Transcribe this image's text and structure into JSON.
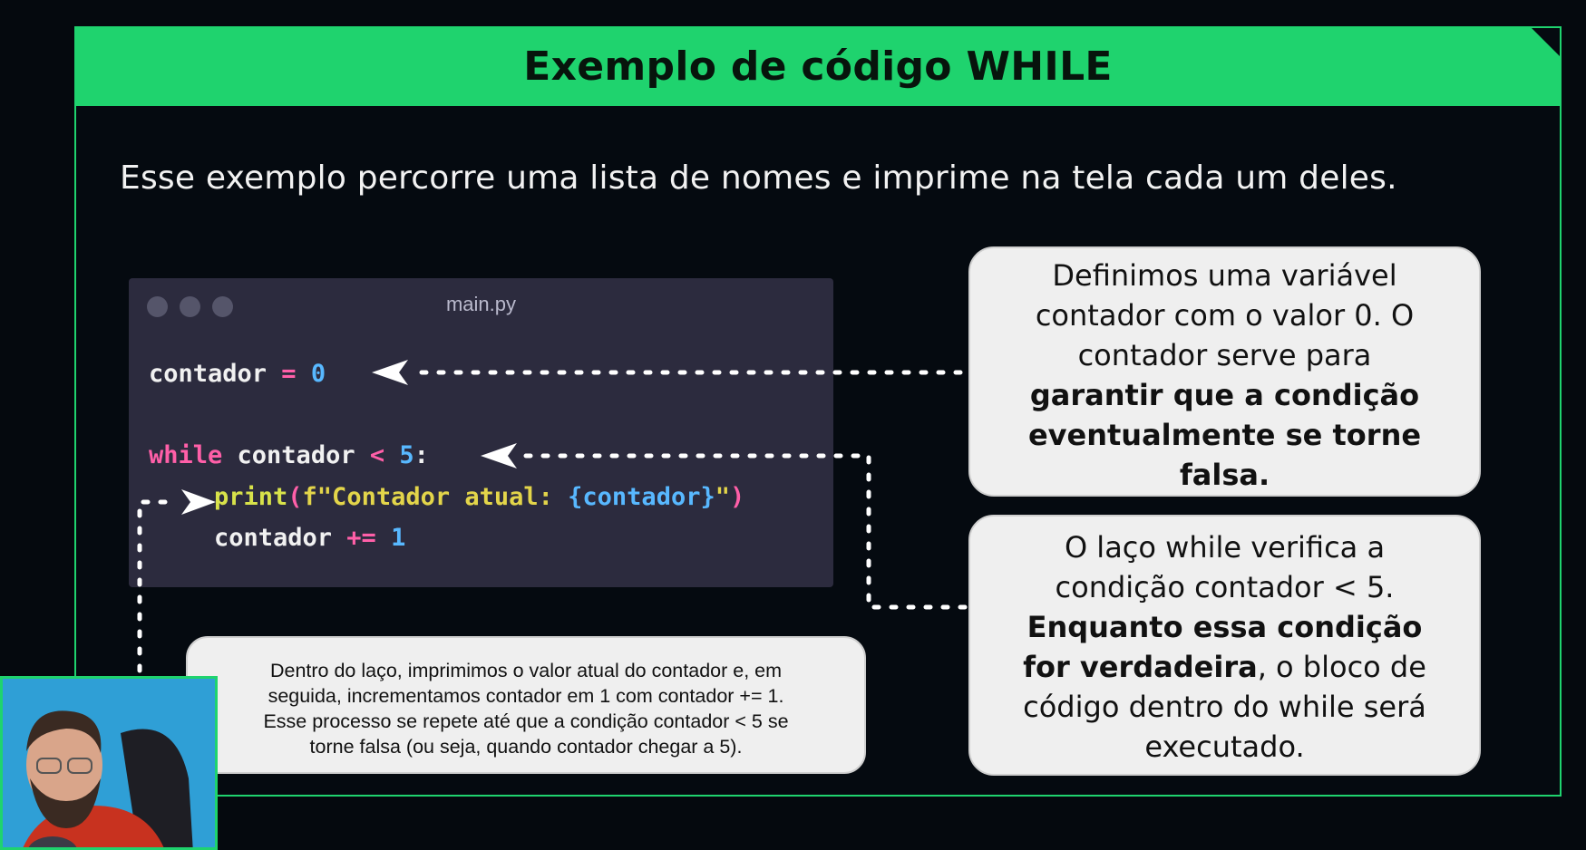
{
  "slide": {
    "title": "Exemplo de código WHILE",
    "intro": "Esse exemplo percorre uma lista de nomes e imprime na tela cada um deles."
  },
  "editor": {
    "filename": "main.py",
    "line1": {
      "var": "contador",
      "op": " = ",
      "num": "0"
    },
    "line2": {
      "kw": "while",
      "var": " contador ",
      "op": "<",
      "num": " 5",
      "punc": ":"
    },
    "line3": {
      "fn": "print",
      "open": "(",
      "str1": "f\"Contador atual: ",
      "brace": "{contador}",
      "str2": "\"",
      "close": ")"
    },
    "line4": {
      "var": "contador",
      "op": " += ",
      "num": "1"
    }
  },
  "callouts": {
    "init": {
      "l1": "Definimos uma variável",
      "l2": "contador com o valor 0. O",
      "l3": "contador serve para",
      "b1": "garantir que a condição",
      "b2": "eventualmente se torne",
      "b3": "falsa."
    },
    "condition": {
      "l1": "O laço while verifica a",
      "l2": "condição contador < 5.",
      "b1": "Enquanto essa condição",
      "b2": "for verdadeira",
      "l3": ", o bloco de",
      "l4": "código dentro do while será",
      "l5": "executado."
    },
    "body": {
      "l1": "Dentro do laço, imprimimos o valor atual do contador e, em",
      "l2": "seguida, incrementamos contador em 1 com contador += 1.",
      "l3": "Esse processo se repete até que a condição contador < 5 se",
      "l4": "torne falsa (ou seja, quando contador chegar a 5)."
    }
  },
  "colors": {
    "accent": "#1fd36e",
    "background": "#05090e",
    "editor_bg": "#2c2b3e"
  }
}
